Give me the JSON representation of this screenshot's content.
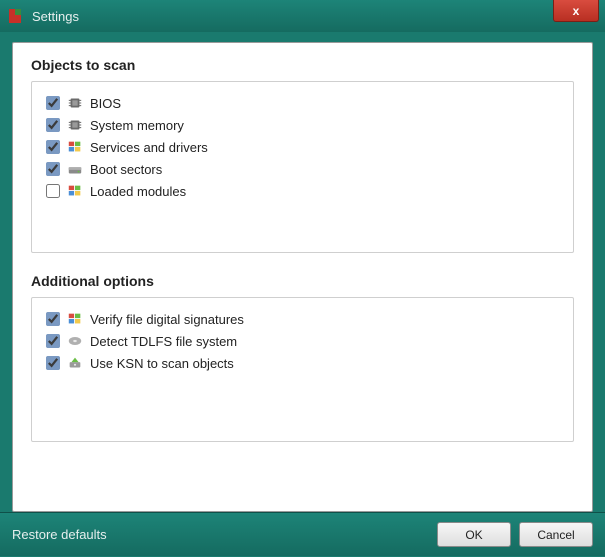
{
  "window": {
    "title": "Settings",
    "close_glyph": "x"
  },
  "sections": {
    "objects": {
      "title": "Objects to scan",
      "items": [
        {
          "label": "BIOS",
          "checked": true,
          "icon": "chip-icon"
        },
        {
          "label": "System memory",
          "checked": true,
          "icon": "chip-icon"
        },
        {
          "label": "Services and drivers",
          "checked": true,
          "icon": "windows-icon"
        },
        {
          "label": "Boot sectors",
          "checked": true,
          "icon": "drive-icon"
        },
        {
          "label": "Loaded modules",
          "checked": false,
          "icon": "windows-icon"
        }
      ]
    },
    "additional": {
      "title": "Additional options",
      "items": [
        {
          "label": "Verify file digital signatures",
          "checked": true,
          "icon": "windows-icon"
        },
        {
          "label": "Detect TDLFS file system",
          "checked": true,
          "icon": "disk-icon"
        },
        {
          "label": "Use KSN to scan objects",
          "checked": true,
          "icon": "scan-icon"
        }
      ]
    }
  },
  "footer": {
    "restore": "Restore defaults",
    "ok": "OK",
    "cancel": "Cancel"
  }
}
